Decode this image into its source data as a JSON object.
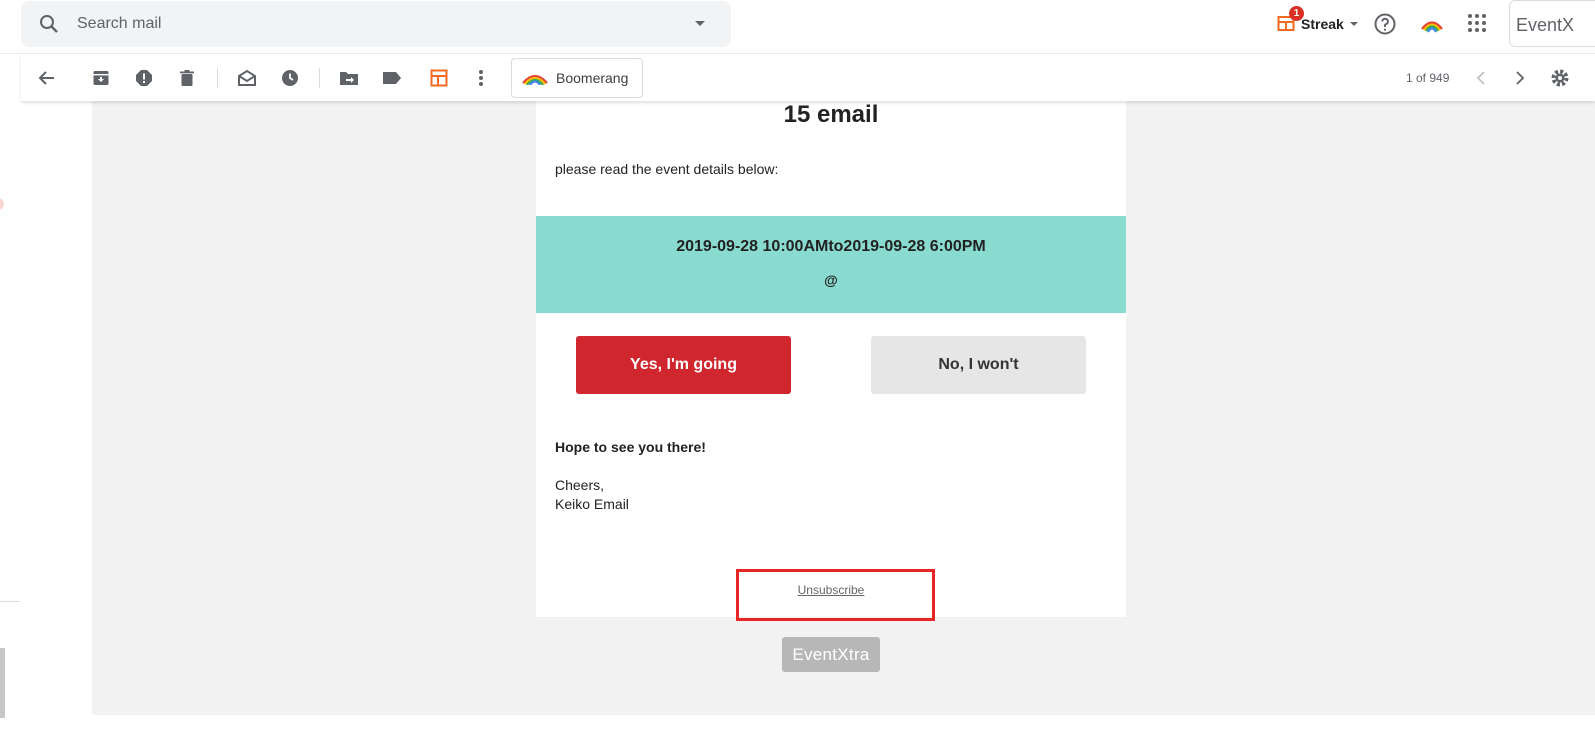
{
  "search": {
    "placeholder": "Search mail"
  },
  "header": {
    "streak_label": "Streak",
    "streak_badge": "1",
    "eventx_label": "EventX",
    "icons": [
      "search-icon",
      "dropdown-caret-icon",
      "streak-icon",
      "help-icon",
      "boomerang-icon",
      "apps-grid-icon"
    ]
  },
  "toolbar": {
    "icons": [
      "back-arrow-icon",
      "archive-icon",
      "report-spam-icon",
      "delete-icon",
      "mark-unread-icon",
      "snooze-icon",
      "move-to-icon",
      "label-icon",
      "streak-box-icon",
      "more-vert-icon"
    ],
    "boomerang_label": "Boomerang",
    "pager": "1 of 949"
  },
  "email": {
    "title": "15 email",
    "intro": "please read the event details below:",
    "event_when": "2019-09-28 10:00AMto2019-09-28 6:00PM",
    "event_where": "@",
    "yes_label": "Yes, I'm going",
    "no_label": "No, I won't",
    "closing": "Hope to see you there!",
    "signoff": "Cheers,",
    "sender": "Keiko Email",
    "unsubscribe": "Unsubscribe",
    "brand": "EventXtra"
  },
  "colors": {
    "event_band": "#8adbcf",
    "yes_button": "#d0262d",
    "no_button": "#e6e6e6",
    "highlight": "#e82626",
    "email_bg": "#f2f2f2"
  }
}
